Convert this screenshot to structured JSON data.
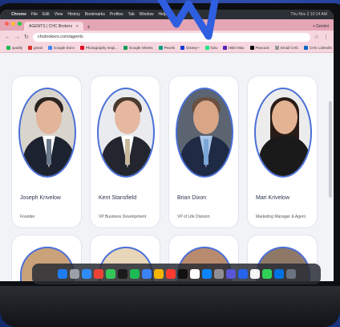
{
  "menubar": {
    "app": "Chrome",
    "items": [
      "File",
      "Edit",
      "View",
      "History",
      "Bookmarks",
      "Profiles",
      "Tab",
      "Window",
      "Help"
    ],
    "clock": "Thu Nov 2 10:14 AM"
  },
  "tab": {
    "title": "AGENTS | CHC Brokers"
  },
  "toolbar": {
    "url": "chcbrokers.com/agents",
    "extra": "+ Gemini"
  },
  "bookmarks": [
    "spotify",
    "gmail",
    "Google Docs",
    "Photography Inspi...",
    "Google Sheets",
    "Pexels",
    "Disney+",
    "hulu",
    "HBO Max",
    "Peacock",
    "Email CHC",
    "CHC LinkedIn"
  ],
  "cards": [
    {
      "name": "Joseph Krivelow",
      "role": "Founder"
    },
    {
      "name": "Kent Stansfield",
      "role": "VP Business Development"
    },
    {
      "name": "Brian Dixon",
      "role": "VP of Life Division"
    },
    {
      "name": "Mari Krivelow",
      "role": "Marketing Manager & Agent"
    }
  ],
  "colors": {
    "accent": "#4a6fd8",
    "browser_chrome": "#f6d7df",
    "background": "#1f3a8a"
  }
}
